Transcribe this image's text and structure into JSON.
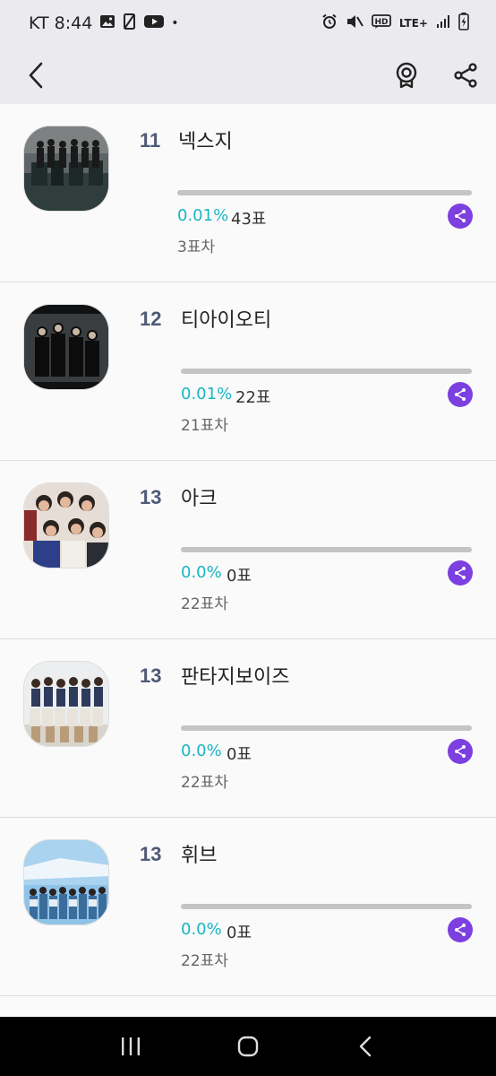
{
  "status_bar": {
    "carrier_time": "KT 8:44",
    "dot": "•",
    "network": "LTE+"
  },
  "colors": {
    "accent_purple": "#7c3fe0",
    "percent_teal": "#19b6c4",
    "rank_slate": "#4e5a78"
  },
  "items": [
    {
      "rank": "11",
      "name": "넥스지",
      "percent": "0.01%",
      "votes": "43표",
      "gap": "3표차",
      "progress": 0.0001,
      "thumb_icon": "group-photo-thumb"
    },
    {
      "rank": "12",
      "name": "티아이오티",
      "percent": "0.01%",
      "votes": "22표",
      "gap": "21표차",
      "progress": 0.0001,
      "thumb_icon": "group-photo-thumb"
    },
    {
      "rank": "13",
      "name": "아크",
      "percent": "0.0%",
      "votes": "0표",
      "gap": "22표차",
      "progress": 0,
      "thumb_icon": "group-photo-thumb"
    },
    {
      "rank": "13",
      "name": "판타지보이즈",
      "percent": "0.0%",
      "votes": "0표",
      "gap": "22표차",
      "progress": 0,
      "thumb_icon": "group-photo-thumb"
    },
    {
      "rank": "13",
      "name": "휘브",
      "percent": "0.0%",
      "votes": "0표",
      "gap": "22표차",
      "progress": 0,
      "thumb_icon": "group-photo-thumb"
    }
  ]
}
